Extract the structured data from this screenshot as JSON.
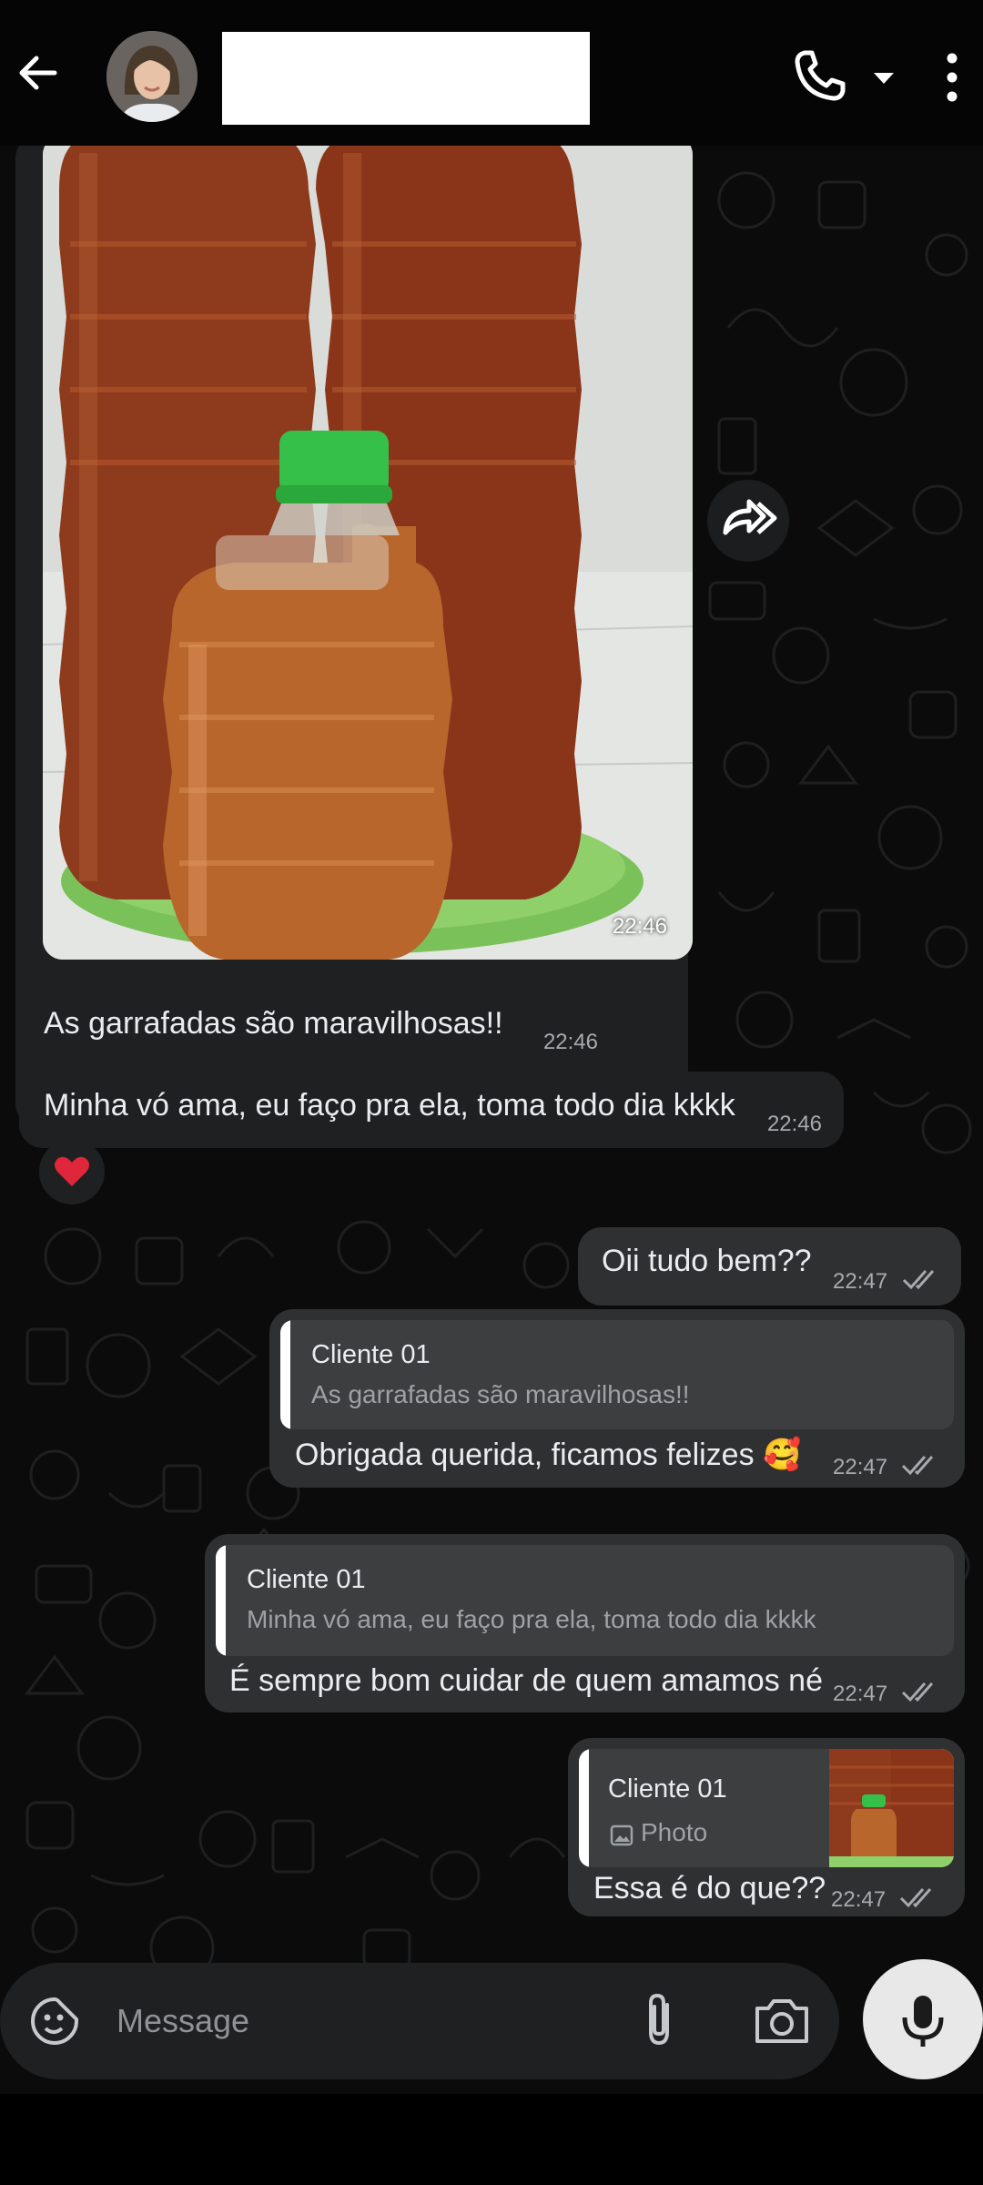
{
  "header": {
    "contact_name": "",
    "back_icon": "arrow-left-icon",
    "call_icon": "phone-icon",
    "menu_icon": "more-vert-icon"
  },
  "messages": [
    {
      "id": "m1",
      "type": "image",
      "direction": "incoming",
      "time": "22:46"
    },
    {
      "id": "m2",
      "type": "text",
      "direction": "incoming",
      "text": "As garrafadas são maravilhosas!!",
      "time": "22:46"
    },
    {
      "id": "m3",
      "type": "text",
      "direction": "incoming",
      "text": "Minha vó ama, eu faço pra ela, toma todo dia kkkk",
      "time": "22:46",
      "reaction": "❤️"
    },
    {
      "id": "m4",
      "type": "text",
      "direction": "outgoing",
      "text": "Oii tudo bem??",
      "time": "22:47",
      "status": "read"
    },
    {
      "id": "m5",
      "type": "reply",
      "direction": "outgoing",
      "quote_author": "Cliente 01",
      "quote_text": "As garrafadas são maravilhosas!!",
      "text": "Obrigada querida, ficamos felizes 🥰",
      "time": "22:47",
      "status": "read"
    },
    {
      "id": "m6",
      "type": "reply",
      "direction": "outgoing",
      "quote_author": "Cliente 01",
      "quote_text": "Minha vó ama, eu faço pra ela, toma todo dia kkkk",
      "text": "É sempre bom cuidar de quem amamos né",
      "time": "22:47",
      "status": "read"
    },
    {
      "id": "m7",
      "type": "reply",
      "direction": "outgoing",
      "quote_author": "Cliente 01",
      "quote_text": "Photo",
      "text": "Essa é do que??",
      "time": "22:47",
      "status": "read"
    }
  ],
  "input": {
    "placeholder": "Message"
  },
  "colors": {
    "background": "#0b0b0b",
    "incoming_bubble": "#1f2021",
    "outgoing_bubble": "#2f3031",
    "quote_box": "#3d3e3f",
    "text": "#e9edef",
    "meta": "#a6abad"
  }
}
